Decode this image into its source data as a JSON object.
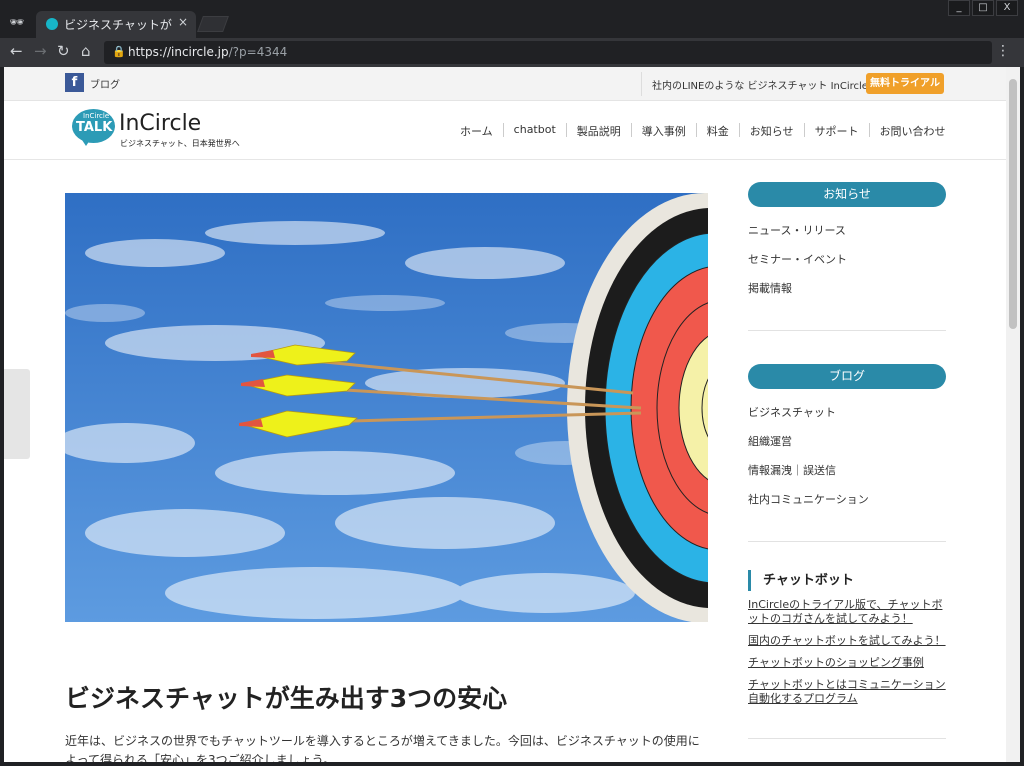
{
  "browser": {
    "tab_title": "ビジネスチャットが生み",
    "tab_close": "×",
    "url_main": "https://incircle.jp",
    "url_rest": "/?p=4344",
    "win_controls": [
      "_",
      "□",
      "X"
    ]
  },
  "topbar": {
    "fb_icon": "f",
    "blog_label": "ブログ",
    "tagline": "社内のLINEのような ビジネスチャット InCircle",
    "trial_button": "無料トライアル"
  },
  "logo": {
    "small": "InCircle",
    "talk": "TALK",
    "name": "InCircle",
    "sub": "ビジネスチャット、日本発世界へ"
  },
  "nav": [
    "ホーム",
    "chatbot",
    "製品説明",
    "導入事例",
    "料金",
    "お知らせ",
    "サポート",
    "お問い合わせ"
  ],
  "article": {
    "title": "ビジネスチャットが生み出す3つの安心",
    "intro": "近年は、ビジネスの世界でもチャットツールを導入するところが増えてきました。今回は、ビジネスチャットの使用によって得られる「安心」を3つご紹介しましょう。"
  },
  "sidebar": {
    "news_head": "お知らせ",
    "news_links": [
      "ニュース・リリース",
      "セミナー・イベント",
      "掲載情報"
    ],
    "blog_head": "ブログ",
    "blog_links": [
      "ビジネスチャット",
      "組織運営",
      "情報漏洩｜誤送信",
      "社内コミュニケーション"
    ],
    "chatbot_head": "チャットボット",
    "chatbot_links": [
      "InCircleのトライアル版で、チャットボットのコガさんを試してみよう！",
      "国内のチャットボットを試してみよう！",
      "チャットボットのショッピング事例",
      "チャットボットとはコミュニケーション自動化するプログラム"
    ]
  }
}
